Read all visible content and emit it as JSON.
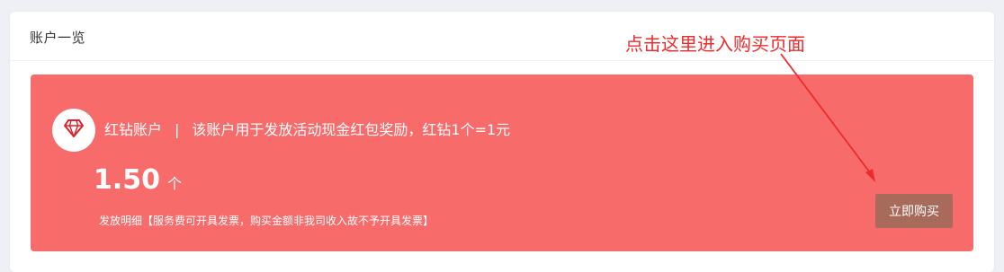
{
  "panel": {
    "title": "账户一览"
  },
  "account": {
    "icon": "diamond-icon",
    "name": "红钻账户",
    "separator": "|",
    "description": "该账户用于发放活动现金红包奖励，红钻1个=1元",
    "balance": "1.50",
    "unit": "个",
    "note": "发放明细【服务费可开具发票，购买金额非我司收入故不予开具发票】",
    "buy_label": "立即购买"
  },
  "annotation": {
    "text": "点击这里进入购买页面"
  },
  "colors": {
    "card": "#f86b6b",
    "button": "#a86a5a",
    "annotation": "#ee2a2a",
    "diamond": "#e0202a"
  }
}
